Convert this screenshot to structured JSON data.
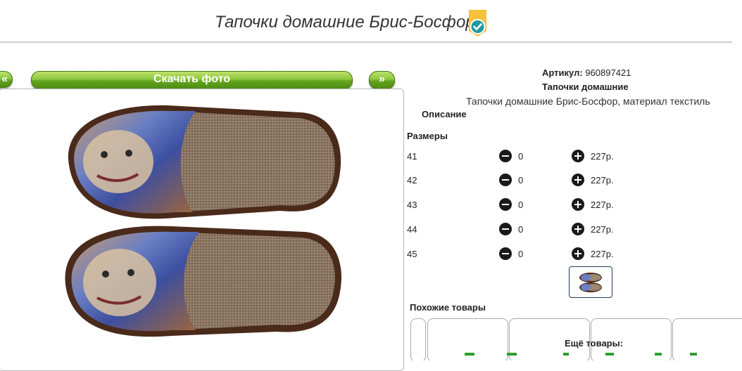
{
  "page": {
    "title": "Тапочки домашние Брис-Босфор"
  },
  "gallery": {
    "prev_label": "«",
    "download_label": "Скачать фото",
    "next_label": "»"
  },
  "product": {
    "article_label": "Артикул:",
    "article_value": "960897421",
    "category": "Тапочки домашние",
    "description_text": "Тапочки домашние Брис-Босфор, материал текстиль",
    "description_label": "Описание",
    "sizes_label": "Размеры",
    "sizes": [
      {
        "size": "41",
        "qty": "0",
        "price": "227р."
      },
      {
        "size": "42",
        "qty": "0",
        "price": "227р."
      },
      {
        "size": "43",
        "qty": "0",
        "price": "227р."
      },
      {
        "size": "44",
        "qty": "0",
        "price": "227р."
      },
      {
        "size": "45",
        "qty": "0",
        "price": "227р."
      }
    ]
  },
  "related": {
    "similar_label": "Похожие товары",
    "more_label": "Ещё товары:"
  },
  "colors": {
    "accent_green": "#7ab92a",
    "badge_yellow": "#f5c33b",
    "check_teal": "#1f9aa0"
  }
}
